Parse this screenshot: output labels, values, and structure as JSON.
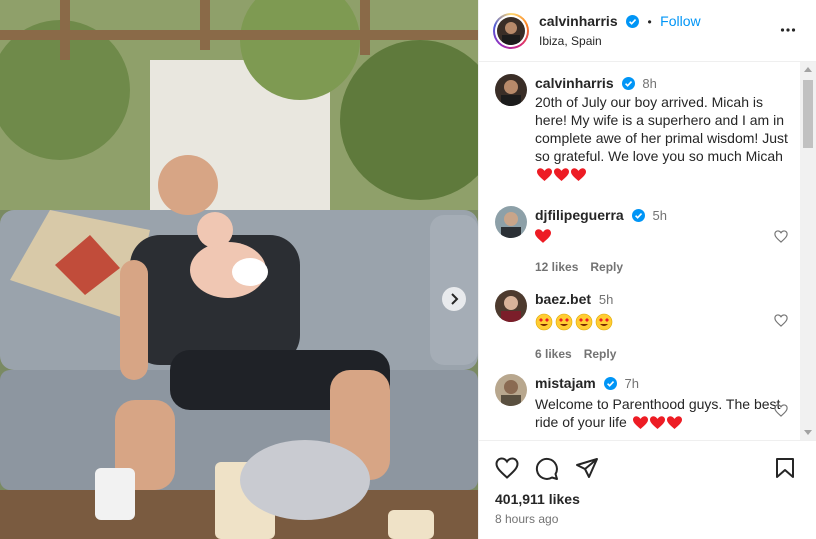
{
  "post": {
    "username": "calvinharris",
    "follow_label": "Follow",
    "dot": "•",
    "location": "Ibiza, Spain",
    "caption": "20th of July our boy arrived. Micah is here! My wife is a superhero and I am in complete awe of her primal wisdom! Just so grateful. We love you so much Micah",
    "caption_time": "8h",
    "likes": "401,911 likes",
    "posted_ago": "8 hours ago"
  },
  "comments": [
    {
      "username": "djfilipeguerra",
      "verified": true,
      "time": "5h",
      "emoji": "red-heart x1",
      "likes": "12 likes",
      "reply": "Reply"
    },
    {
      "username": "baez.bet",
      "verified": false,
      "time": "5h",
      "emoji": "heart-eyes-face x4",
      "likes": "6 likes",
      "reply": "Reply"
    },
    {
      "username": "mistajam",
      "verified": true,
      "time": "7h",
      "text": "Welcome to Parenthood guys. The best ride of your life",
      "emoji": "red-heart x3"
    }
  ],
  "icons": {
    "verified": "verified-badge-icon",
    "more": "more-options-icon",
    "like": "heart-outline-icon",
    "comment": "comment-bubble-icon",
    "share": "paper-plane-icon",
    "save": "bookmark-icon",
    "next": "chevron-right-icon"
  },
  "colors": {
    "accent": "#0095f6",
    "verified": "#0095f6",
    "heart": "#ed1c24"
  }
}
